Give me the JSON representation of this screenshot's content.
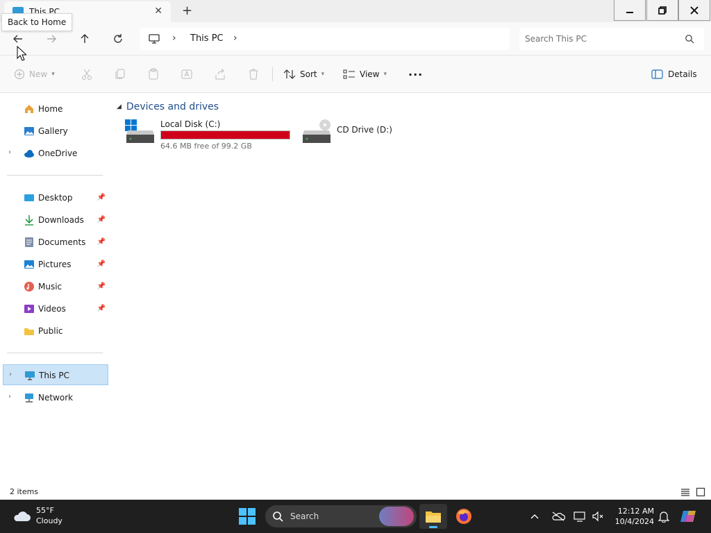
{
  "window": {
    "tab_title": "This PC",
    "tooltip": "Back to Home"
  },
  "address": {
    "breadcrumb": "This PC",
    "search_placeholder": "Search This PC"
  },
  "commands": {
    "new": "New",
    "sort": "Sort",
    "view": "View",
    "more": "···",
    "details": "Details"
  },
  "sidebar": {
    "quick": [
      {
        "label": "Home",
        "icon": "home-icon"
      },
      {
        "label": "Gallery",
        "icon": "gallery-icon"
      },
      {
        "label": "OneDrive",
        "icon": "onedrive-icon"
      }
    ],
    "pinned": [
      {
        "label": "Desktop",
        "icon": "desktop-icon"
      },
      {
        "label": "Downloads",
        "icon": "downloads-icon"
      },
      {
        "label": "Documents",
        "icon": "documents-icon"
      },
      {
        "label": "Pictures",
        "icon": "pictures-icon"
      },
      {
        "label": "Music",
        "icon": "music-icon"
      },
      {
        "label": "Videos",
        "icon": "videos-icon"
      },
      {
        "label": "Public",
        "icon": "folder-icon"
      }
    ],
    "locations": [
      {
        "label": "This PC",
        "icon": "this-pc-icon"
      },
      {
        "label": "Network",
        "icon": "network-icon"
      }
    ]
  },
  "content": {
    "group_title": "Devices and drives",
    "drives": [
      {
        "name": "Local Disk (C:)",
        "free_text": "64.6 MB free of 99.2 GB",
        "used_fraction": 0.9994,
        "bar_color": "#d0021b"
      },
      {
        "name": "CD Drive (D:)"
      }
    ]
  },
  "status": {
    "item_count": "2 items"
  },
  "taskbar": {
    "temperature": "55°F",
    "condition": "Cloudy",
    "search_label": "Search",
    "time": "12:12 AM",
    "date": "10/4/2024"
  }
}
